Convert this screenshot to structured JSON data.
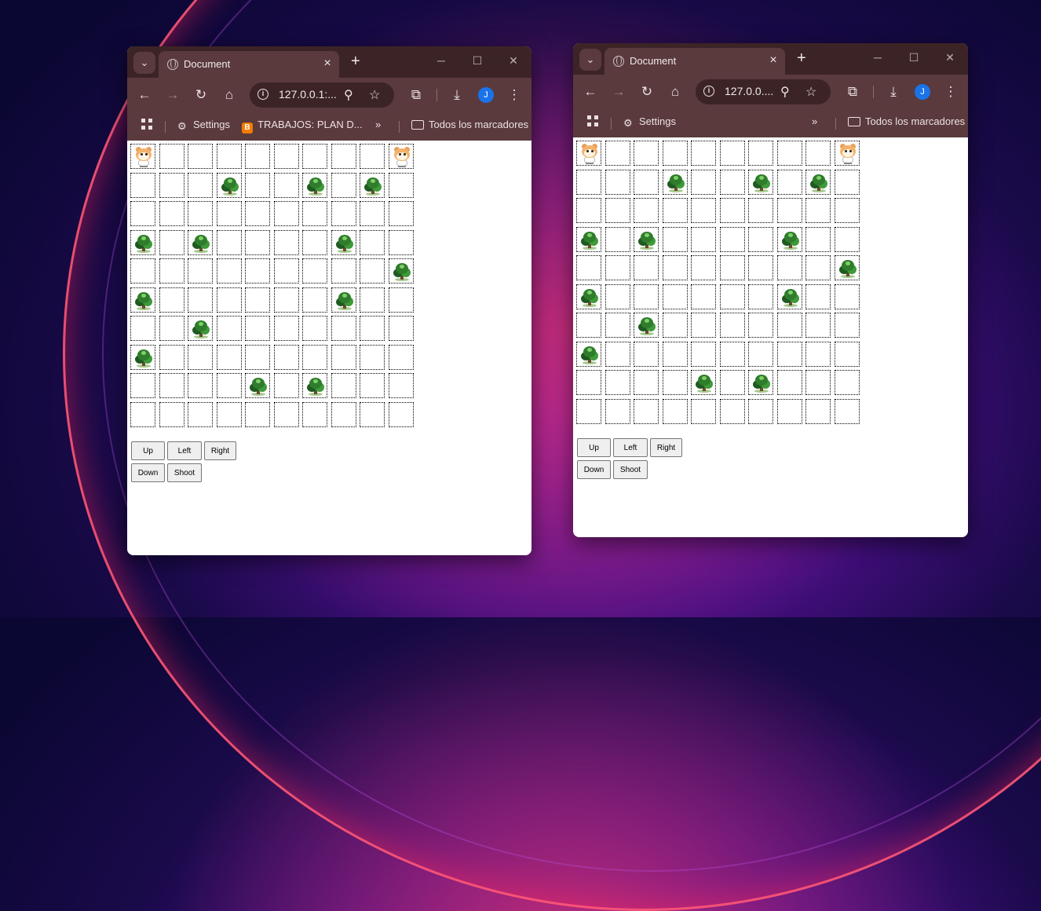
{
  "windows": [
    {
      "tab_title": "Document",
      "url": "127.0.0.1:...",
      "bookmarks": [
        "Settings",
        "TRABAJOS: PLAN D...",
        "Todos los marcadores"
      ],
      "avatar_initial": "J",
      "grid": {
        "rows": 10,
        "cols": 10,
        "hamsters": [
          [
            0,
            0
          ],
          [
            0,
            9
          ]
        ],
        "trees": [
          [
            1,
            3
          ],
          [
            1,
            6
          ],
          [
            1,
            8
          ],
          [
            3,
            0
          ],
          [
            3,
            2
          ],
          [
            3,
            7
          ],
          [
            4,
            9
          ],
          [
            5,
            0
          ],
          [
            5,
            7
          ],
          [
            6,
            2
          ],
          [
            7,
            0
          ],
          [
            8,
            4
          ],
          [
            8,
            6
          ]
        ]
      },
      "buttons": {
        "up": "Up",
        "left": "Left",
        "right": "Right",
        "down": "Down",
        "shoot": "Shoot"
      }
    },
    {
      "tab_title": "Document",
      "url": "127.0.0....",
      "bookmarks": [
        "Settings",
        "Todos los marcadores"
      ],
      "avatar_initial": "J",
      "grid": {
        "rows": 10,
        "cols": 10,
        "hamsters": [
          [
            0,
            0
          ],
          [
            0,
            9
          ]
        ],
        "trees": [
          [
            1,
            3
          ],
          [
            1,
            6
          ],
          [
            1,
            8
          ],
          [
            3,
            0
          ],
          [
            3,
            2
          ],
          [
            3,
            7
          ],
          [
            4,
            9
          ],
          [
            5,
            0
          ],
          [
            5,
            7
          ],
          [
            6,
            2
          ],
          [
            7,
            0
          ],
          [
            8,
            4
          ],
          [
            8,
            6
          ]
        ]
      },
      "buttons": {
        "up": "Up",
        "left": "Left",
        "right": "Right",
        "down": "Down",
        "shoot": "Shoot"
      }
    }
  ],
  "icons": {
    "tab_search": "chevron-down-icon",
    "close": "close-icon",
    "new_tab": "plus-icon",
    "back": "arrow-left-icon",
    "forward": "arrow-right-icon",
    "reload": "reload-icon",
    "home": "home-icon",
    "zoom": "magnifier-zoom-icon",
    "bookmark": "star-icon",
    "extensions": "puzzle-icon",
    "downloads": "download-icon",
    "menu": "kebab-menu-icon"
  },
  "colors": {
    "chrome_frame": "#3c2426",
    "chrome_toolbar": "#5a3a3d",
    "avatar": "#1a73e8",
    "tree": "#2f7d2c",
    "hamster": "#f3b26a"
  }
}
